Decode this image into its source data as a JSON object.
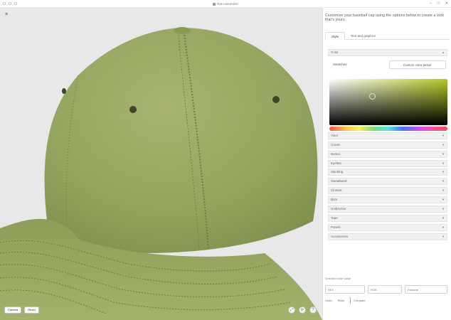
{
  "window": {
    "title": "Hat customizer",
    "controls": [
      "–",
      "□",
      "✕"
    ]
  },
  "viewport": {
    "menu_icon": "≡",
    "buttons": [
      "Camera",
      "Reset"
    ],
    "tool_icons": [
      "⤢",
      "⟳",
      "?"
    ]
  },
  "panel": {
    "heading": "Customize your baseball cap using the options below to create a look that's yours.",
    "tabs": [
      "Style",
      "Text and graphics"
    ],
    "color": {
      "label": "Color",
      "tabs": [
        "Swatches",
        "Custom color picker"
      ]
    },
    "sections": [
      "Visor",
      "Crown",
      "Button",
      "Eyelets",
      "Stitching",
      "Sweatband",
      "Closure",
      "Brim",
      "Undervisor",
      "Tape",
      "Panels",
      "Accessories"
    ],
    "footer": {
      "label": "Selected color value",
      "inputs": [
        "HEX",
        "RGB",
        "Pantone"
      ],
      "bottom": [
        "Undo",
        "Redo",
        "Compare"
      ]
    }
  }
}
